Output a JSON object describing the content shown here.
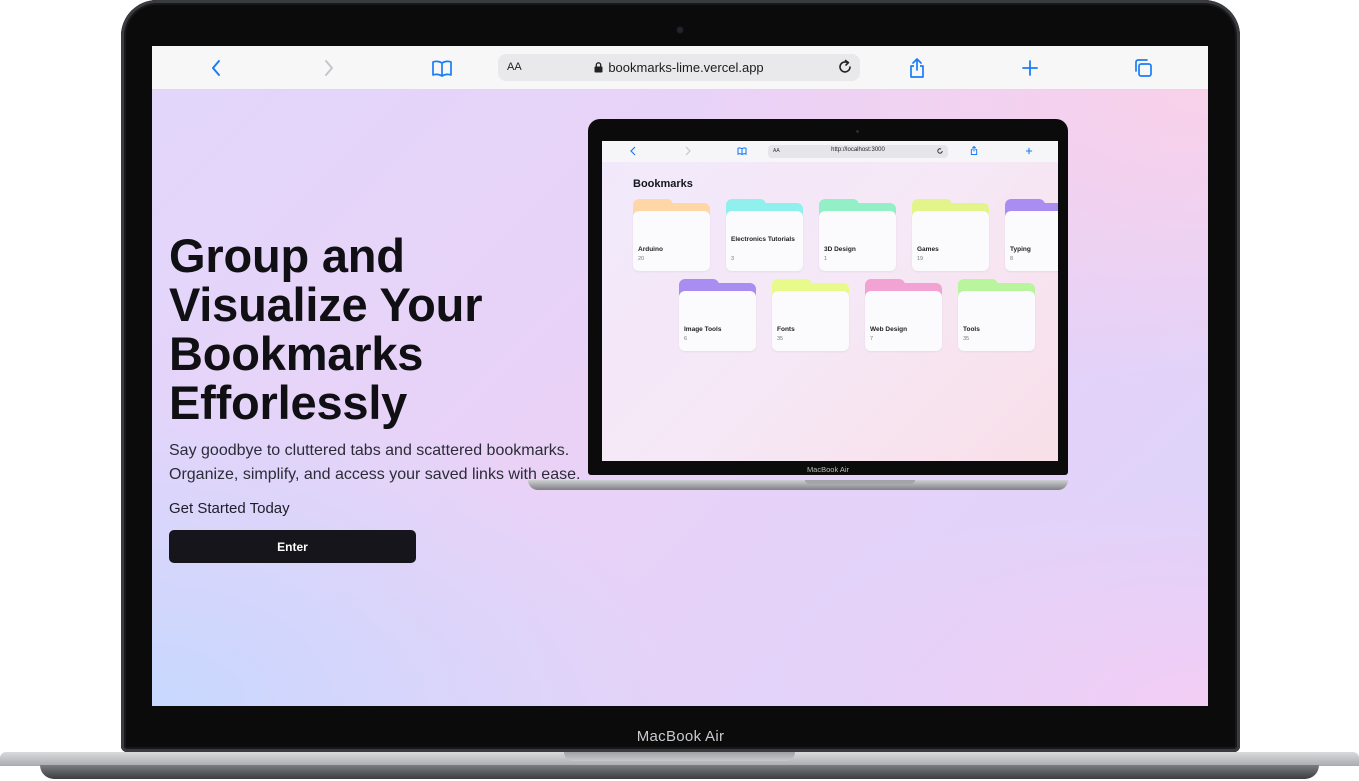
{
  "device": {
    "label": "MacBook Air"
  },
  "browser": {
    "text_size_label": "AA",
    "url": "bookmarks-lime.vercel.app",
    "icons": [
      "back-icon",
      "forward-icon",
      "bookmarks-icon",
      "lock-icon",
      "reload-icon",
      "share-icon",
      "new-tab-icon",
      "tabs-icon"
    ]
  },
  "hero": {
    "title_lines": [
      "Group and",
      "Visualize Your",
      "Bookmarks",
      "Efforlessly"
    ],
    "subtitle_lines": [
      "Say goodbye to cluttered tabs and scattered bookmarks.",
      "Organize, simplify, and access your saved links with ease."
    ],
    "cta_label": "Get Started Today",
    "button_label": "Enter"
  },
  "preview": {
    "device_label": "MacBook Air",
    "browser": {
      "text_size_label": "AA",
      "url": "http://localhost:3000"
    },
    "page_title": "Bookmarks",
    "folders": [
      {
        "name": "Arduino",
        "count": "20",
        "color": "#ffd7a6"
      },
      {
        "name": "Electronics Tutorials",
        "count": "3",
        "color": "#8ff0ee"
      },
      {
        "name": "3D Design",
        "count": "1",
        "color": "#93f0c6"
      },
      {
        "name": "Games",
        "count": "19",
        "color": "#e3f58a"
      },
      {
        "name": "Typing",
        "count": "8",
        "color": "#a98df0"
      },
      {
        "name": "Image Tools",
        "count": "6",
        "color": "#a98df0"
      },
      {
        "name": "Fonts",
        "count": "35",
        "color": "#e7fa8a"
      },
      {
        "name": "Web Design",
        "count": "7",
        "color": "#f3a2d4"
      },
      {
        "name": "Tools",
        "count": "35",
        "color": "#b8f59c"
      }
    ]
  },
  "colors": {
    "button_bg": "#16151b",
    "title_text": "#0f0f14"
  }
}
